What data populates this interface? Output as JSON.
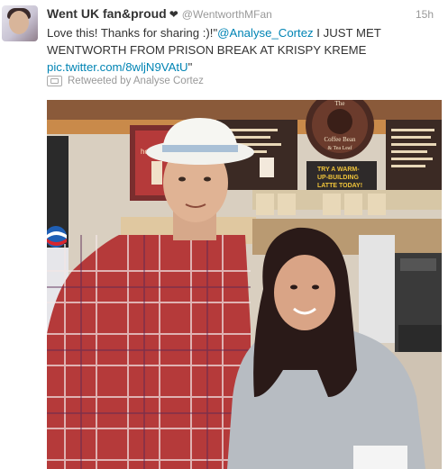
{
  "tweet": {
    "user": {
      "full_name": "Went UK fan&proud",
      "heart": "❤",
      "screen_name": "@WentworthMFan"
    },
    "timestamp": "15h",
    "text": {
      "intro": "Love this! Thanks for sharing :)!\"",
      "mention": "@Analyse_Cortez",
      "body": " I JUST MET WENTWORTH FROM PRISON BREAK AT KRISPY KREME",
      "link": "pic.twitter.com/8wljN9VAtU",
      "end_quote": "\""
    },
    "retweet_context": "Retweeted by Analyse Cortez"
  },
  "photo": {
    "sign_the_line1": "The",
    "sign_the_line2": "Coffee Bean",
    "sign_the_line3": "& Tea Leaf",
    "promo_line1": "TRY A WARM-",
    "promo_line2": "UP-BUILDING",
    "promo_line3": "LATTE TODAY!",
    "holiday_text": "holiday wishes"
  }
}
